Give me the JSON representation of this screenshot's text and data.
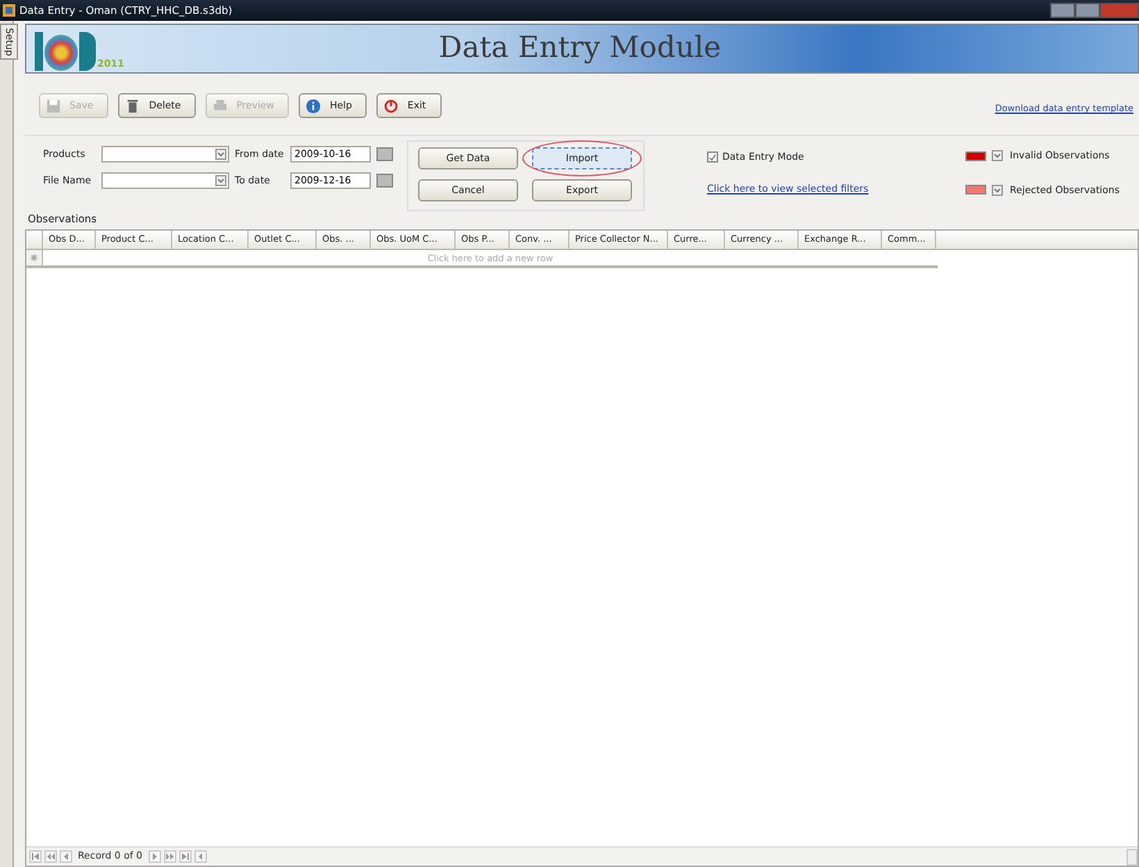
{
  "window": {
    "title": "Data Entry - Oman (CTRY_HHC_DB.s3db)"
  },
  "side_tab": {
    "label": "Setup"
  },
  "banner": {
    "logo_year": "2011",
    "title": "Data Entry Module"
  },
  "toolbar": [
    {
      "label": "Save",
      "kind": "disk",
      "disabled": true
    },
    {
      "label": "Delete",
      "kind": "trash",
      "disabled": false
    },
    {
      "label": "Preview",
      "kind": "printer",
      "disabled": true
    },
    {
      "label": "Help",
      "kind": "info",
      "disabled": false
    },
    {
      "label": "Exit",
      "kind": "power",
      "disabled": false
    }
  ],
  "download_link": "Download data entry template",
  "filters": {
    "products_label": "Products",
    "file_name_label": "File Name",
    "from_date_label": "From date",
    "from_date": "2009-10-16",
    "to_date_label": "To date",
    "to_date": "2009-12-16"
  },
  "actions": [
    {
      "label": "Get Data",
      "highlighted": false
    },
    {
      "label": "Import",
      "highlighted": true
    },
    {
      "label": "Cancel",
      "highlighted": false
    },
    {
      "label": "Export",
      "highlighted": false
    }
  ],
  "data_entry_mode": {
    "label": "Data Entry Mode",
    "checked": true
  },
  "filters_link": "Click here to view selected filters",
  "legend": [
    {
      "label": "Invalid Observations",
      "color": "#d40000"
    },
    {
      "label": "Rejected Observations",
      "color": "#f07a72"
    }
  ],
  "observations": {
    "title": "Observations",
    "columns": [
      "Obs D...",
      "Product C...",
      "Location C...",
      "Outlet C...",
      "Obs. ...",
      "Obs. UoM C...",
      "Obs P...",
      "Conv. ...",
      "Price Collector N...",
      "Curre...",
      "Currency ...",
      "Exchange R...",
      "Comm..."
    ],
    "new_row_hint": "Click here to add a new row"
  },
  "navigator": {
    "record": "Record 0 of 0"
  }
}
